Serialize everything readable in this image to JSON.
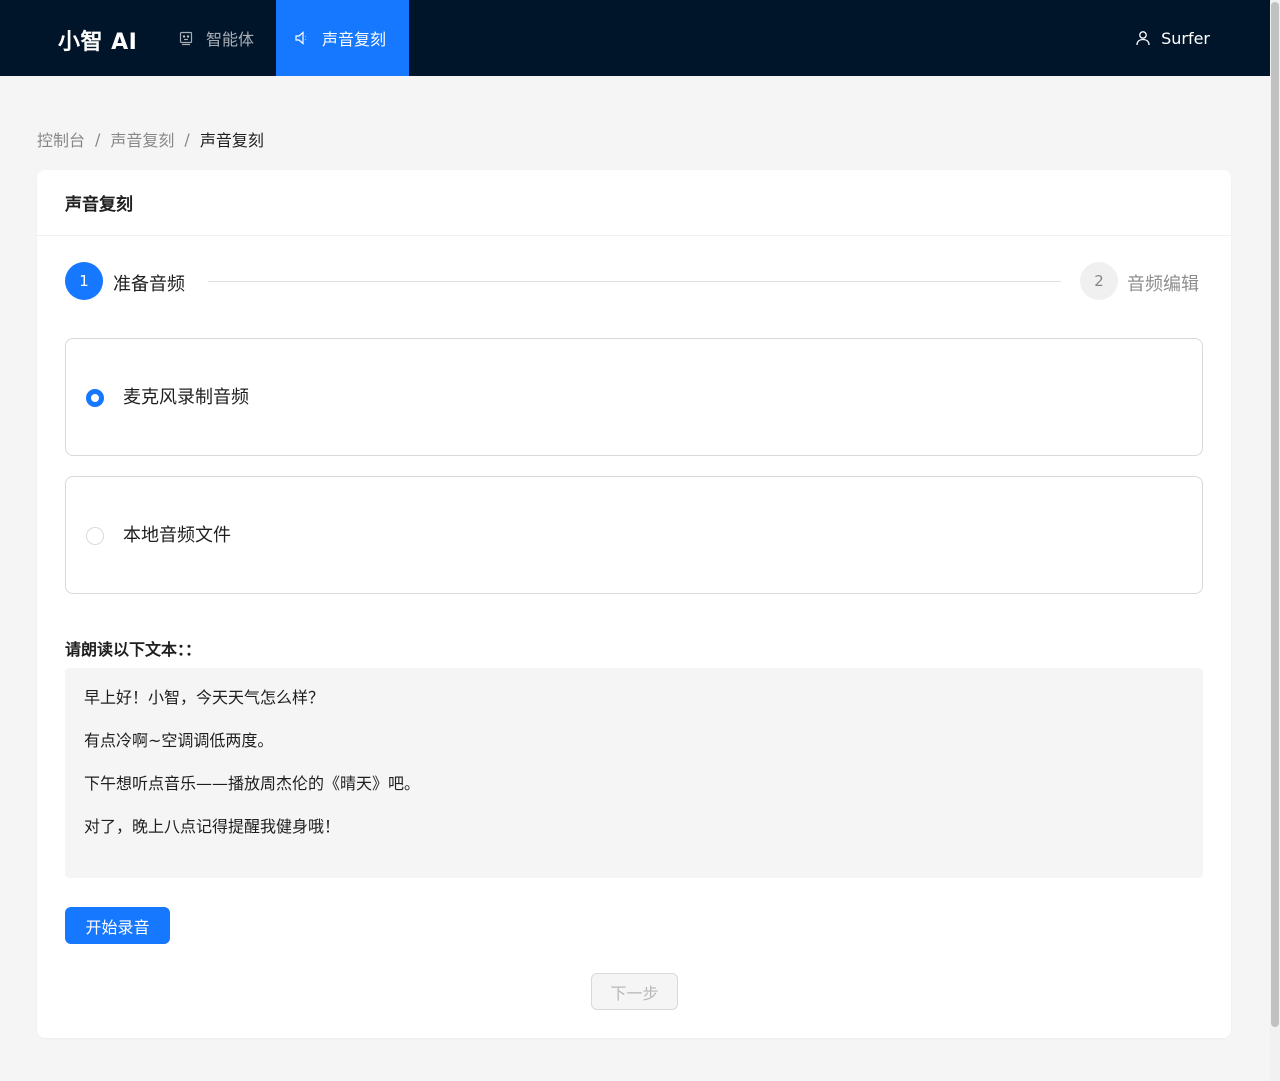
{
  "header": {
    "logo": "小智 AI",
    "nav": [
      {
        "label": "智能体",
        "icon": "robot-icon",
        "active": false
      },
      {
        "label": "声音复刻",
        "icon": "sound-icon",
        "active": true
      }
    ],
    "user": {
      "name": "Surfer",
      "icon": "user-icon"
    }
  },
  "breadcrumb": [
    "控制台",
    "声音复刻",
    "声音复刻"
  ],
  "card": {
    "title": "声音复刻",
    "steps": [
      {
        "number": "1",
        "title": "准备音频",
        "status": "active"
      },
      {
        "number": "2",
        "title": "音频编辑",
        "status": "wait"
      }
    ],
    "options": [
      {
        "label": "麦克风录制音频",
        "checked": true
      },
      {
        "label": "本地音频文件",
        "checked": false
      }
    ],
    "read_title": "请朗读以下文本：：",
    "read_lines": [
      "早上好！小智，今天天气怎么样？",
      "有点冷啊~空调调低两度。",
      "下午想听点音乐——播放周杰伦的《晴天》吧。",
      "对了，晚上八点记得提醒我健身哦！"
    ],
    "record_button": "开始录音",
    "next_button": "下一步"
  },
  "colors": {
    "header_bg": "#001529",
    "primary": "#1677ff",
    "page_bg": "#f5f5f5"
  }
}
